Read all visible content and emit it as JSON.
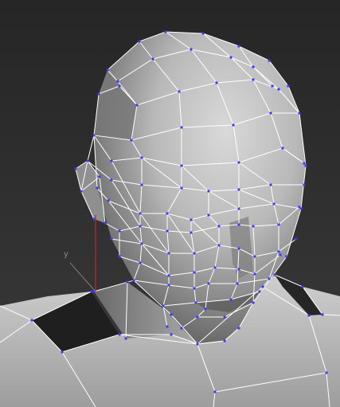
{
  "viewport": {
    "background_top": "#262626",
    "background_bottom": "#3a3a3a",
    "wire_color": "#ffffff",
    "vertex_color": "#3a3aff",
    "axis_color_y": "#c02828"
  },
  "gizmo": {
    "axis_label": "y"
  }
}
